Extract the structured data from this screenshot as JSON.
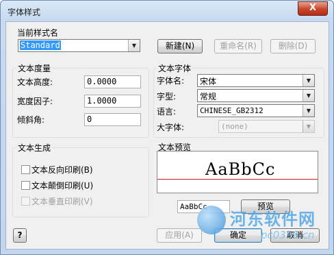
{
  "window": {
    "title": "字体样式",
    "close_glyph": "X"
  },
  "current_style": {
    "label": "当前样式名",
    "value": "Standard",
    "new_button": "新建(N)",
    "rename_button": "重命名(R)",
    "delete_button": "删除(D)"
  },
  "measure": {
    "label": "文本度量",
    "height_label": "文本高度:",
    "height_value": "0.0000",
    "width_label": "宽度因子:",
    "width_value": "1.0000",
    "oblique_label": "倾斜角:",
    "oblique_value": "0"
  },
  "font": {
    "label": "文本字体",
    "name_label": "字体名:",
    "name_value": "宋体",
    "style_label": "字型:",
    "style_value": "常规",
    "language_label": "语言:",
    "language_value": "CHINESE_GB2312",
    "bigfont_label": "大字体:",
    "bigfont_value": "(none)"
  },
  "generate": {
    "label": "文本生成",
    "backwards": "文本反向印刷(B)",
    "upside_down": "文本颠倒印刷(U)",
    "vertical": "文本垂直印刷(V)"
  },
  "preview": {
    "label": "文本预览",
    "sample": "AaBbCc",
    "input_value": "AaBbCc",
    "button": "预览"
  },
  "footer": {
    "help": "?",
    "apply": "应用(A)",
    "ok": "确定",
    "cancel": "取消"
  },
  "watermark": {
    "text": "河东软件网",
    "url": "pc0359.cn"
  }
}
